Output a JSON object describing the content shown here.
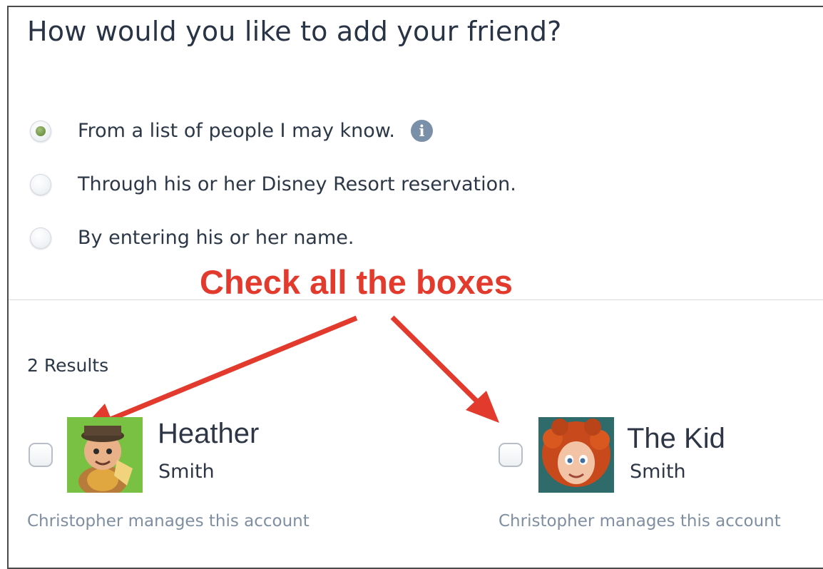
{
  "dialog": {
    "title": "How would you like to add your friend?"
  },
  "add_options": [
    {
      "label": "From a list of people I may know.",
      "selected": true
    },
    {
      "label": "Through his or her Disney Resort reservation.",
      "selected": false
    },
    {
      "label": "By entering his or her name.",
      "selected": false
    }
  ],
  "annotation": {
    "text": "Check all the boxes",
    "color": "#e23a2c"
  },
  "results": {
    "count_label": "2 Results",
    "items": [
      {
        "first_name": "Heather",
        "last_name": "Smith",
        "manager_note": "Christopher manages this account",
        "checked": false
      },
      {
        "first_name": "The Kid",
        "last_name": "Smith",
        "manager_note": "Christopher manages this account",
        "checked": false
      }
    ]
  },
  "colors": {
    "selected_radio": "#6f9447",
    "info_icon": "#7a8fa8",
    "muted_text": "#7f8ea0"
  }
}
